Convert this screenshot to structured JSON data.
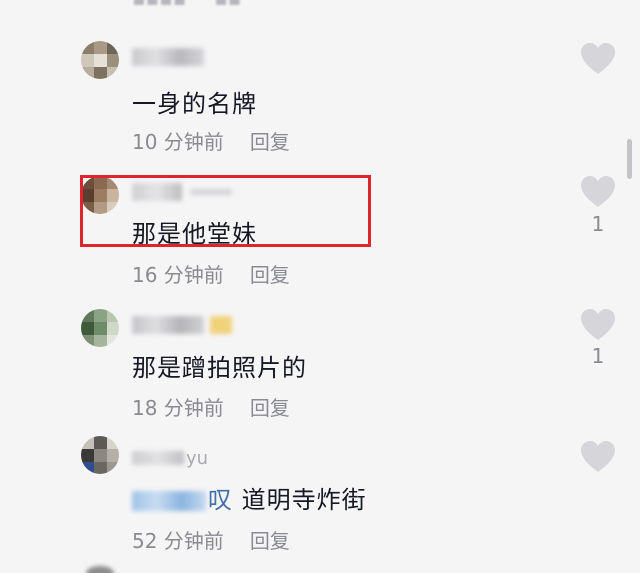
{
  "colors": {
    "background": "#f5f5f6",
    "primary_text": "#161823",
    "secondary_text": "#8a8b91",
    "highlight_border": "#e0232d",
    "mention": "#3f6fa9",
    "like_icon": "#d6d6da"
  },
  "comments": [
    {
      "text": "一身的名牌",
      "time": "10 分钟前",
      "reply_label": "回复",
      "like_count": ""
    },
    {
      "text": "那是他堂妹",
      "time": "16 分钟前",
      "reply_label": "回复",
      "like_count": "1"
    },
    {
      "text": "那是蹭拍照片的",
      "time": "18 分钟前",
      "reply_label": "回复",
      "like_count": "1"
    },
    {
      "username_tail": "yu",
      "mention_tail": "叹",
      "text": "道明寺炸街",
      "time": "52 分钟前",
      "reply_label": "回复",
      "like_count": ""
    }
  ],
  "icons": {
    "like": "heart-icon",
    "avatar": "avatar-image"
  }
}
